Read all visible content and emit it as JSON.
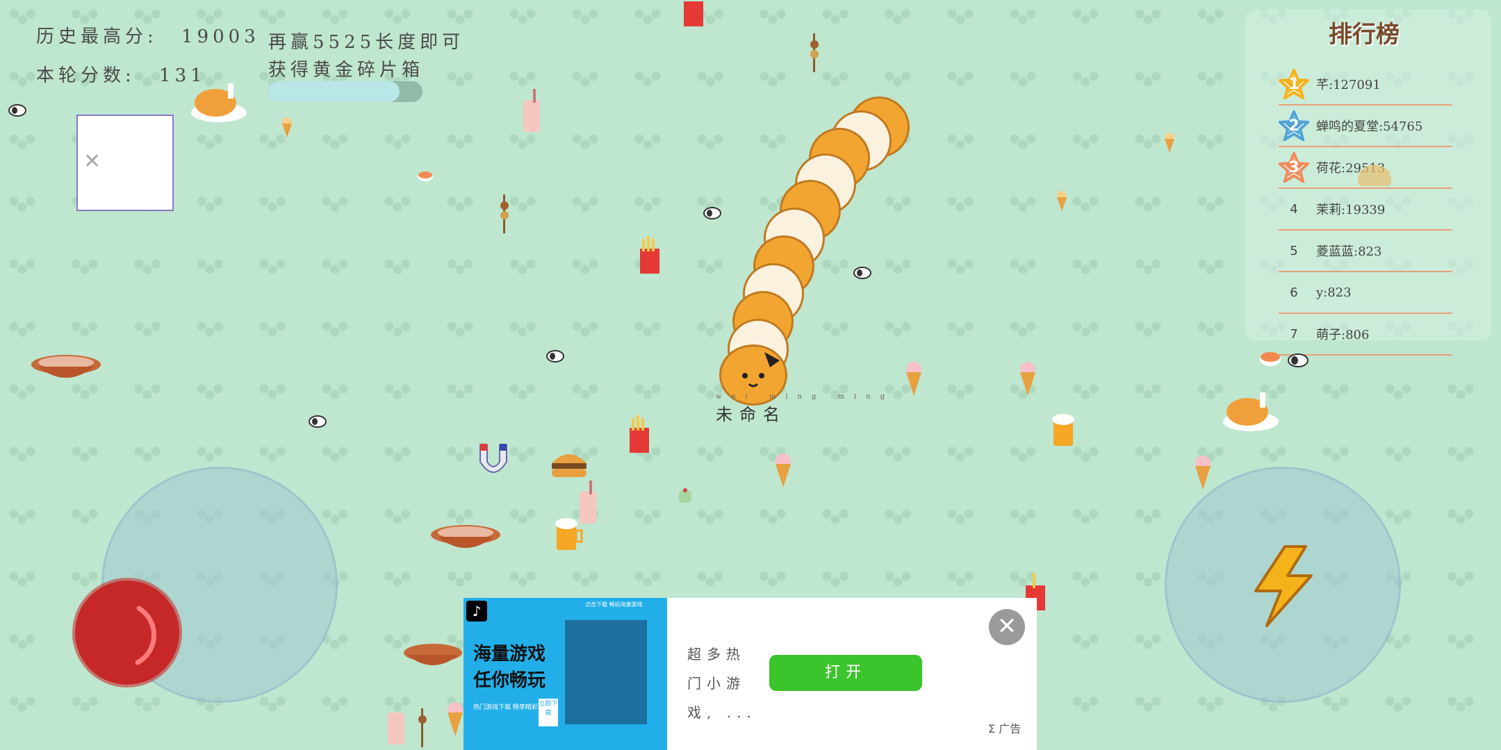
{
  "hud": {
    "best_score_label": "历史最高分:",
    "best_score_value": "19003",
    "round_score_label": "本轮分数:",
    "round_score_value": "131",
    "goal_line1": "再赢5525长度即可",
    "goal_line2": "获得黄金碎片箱",
    "goal_progress_fraction": 0.85
  },
  "leaderboard": {
    "title": "排行榜",
    "rows": [
      {
        "rank": "1",
        "text": "芊:127091"
      },
      {
        "rank": "2",
        "text": "蝉鸣的夏堂:54765"
      },
      {
        "rank": "3",
        "text": "荷花:29513"
      },
      {
        "rank": "4",
        "text": "茉莉:19339"
      },
      {
        "rank": "5",
        "text": "菱蓝蓝:823"
      },
      {
        "rank": "6",
        "text": "y:823"
      },
      {
        "rank": "7",
        "text": "萌子:806"
      }
    ]
  },
  "player": {
    "name": "未命名"
  },
  "colors": {
    "background": "#bfe6cf",
    "snake_orange": "#f2a531",
    "snake_cream": "#fbf1df",
    "boost_yellow": "#f5b21a",
    "ad_open_green": "#3cc42c"
  },
  "icons": {
    "boost": "lightning-icon",
    "close": "close-icon"
  },
  "ad": {
    "headline": "海量游戏任你畅玩",
    "sub": "热门游戏下载 畅享精彩游戏",
    "download": "立即下载",
    "top_text": "点击下载 畅玩海量游戏",
    "description": "超多热门小游戏, ...",
    "open_label": "打开",
    "ad_label": "Σ 广告",
    "close_glyph": "✕"
  }
}
